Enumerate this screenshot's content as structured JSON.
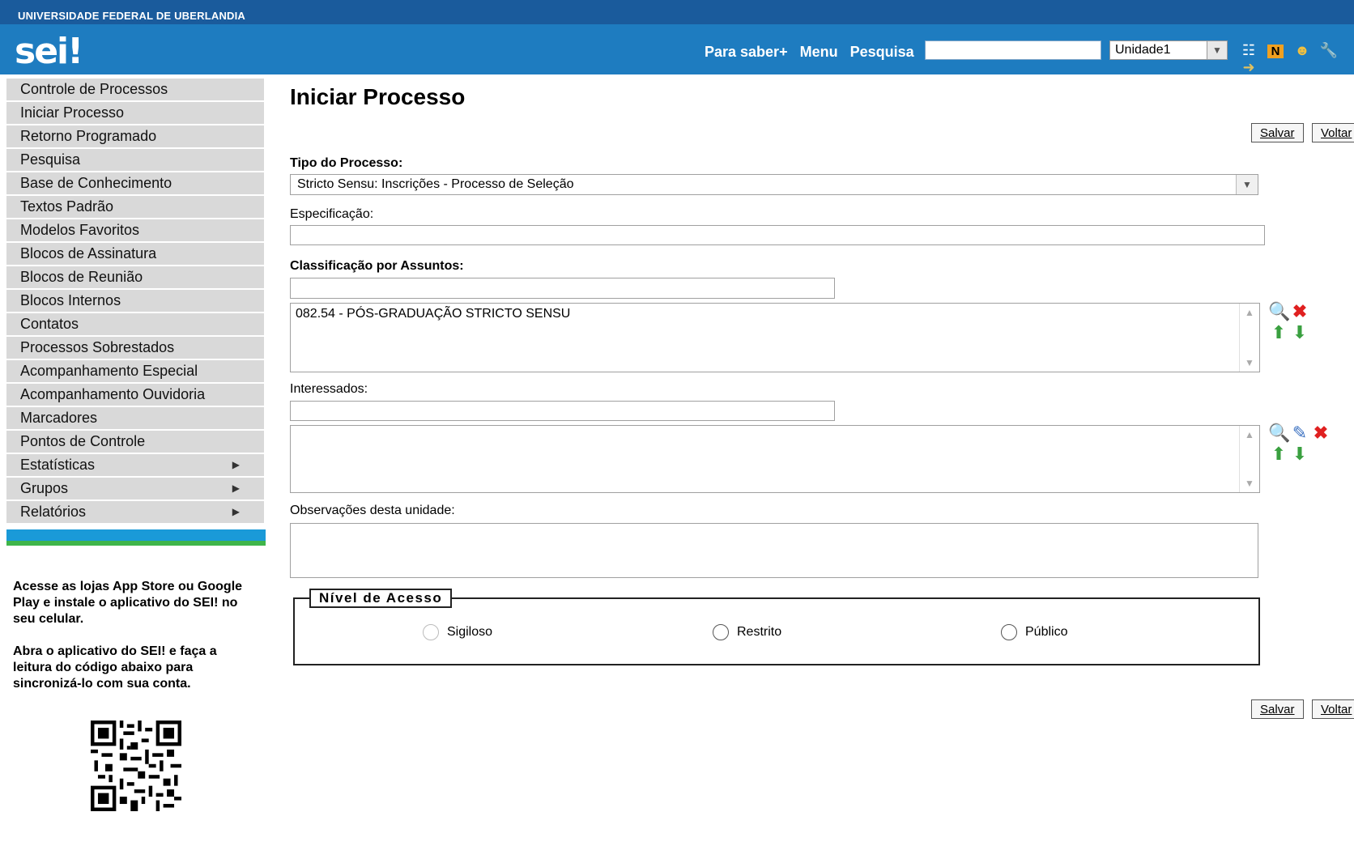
{
  "header": {
    "institution": "UNIVERSIDADE FEDERAL DE UBERLANDIA",
    "logo": "sei!",
    "nav": [
      "Para saber+",
      "Menu",
      "Pesquisa"
    ],
    "search_value": "",
    "unit_select": "Unidade1",
    "icons": [
      "list-icon",
      "n-badge-icon",
      "user-icon",
      "wrench-icon",
      "exit-icon"
    ]
  },
  "sidebar": {
    "items": [
      {
        "label": "Controle de Processos"
      },
      {
        "label": "Iniciar Processo"
      },
      {
        "label": "Retorno Programado"
      },
      {
        "label": "Pesquisa"
      },
      {
        "label": "Base de Conhecimento"
      },
      {
        "label": "Textos Padrão"
      },
      {
        "label": "Modelos Favoritos"
      },
      {
        "label": "Blocos de Assinatura"
      },
      {
        "label": "Blocos de Reunião"
      },
      {
        "label": "Blocos Internos"
      },
      {
        "label": "Contatos"
      },
      {
        "label": "Processos Sobrestados"
      },
      {
        "label": "Acompanhamento Especial"
      },
      {
        "label": "Acompanhamento Ouvidoria"
      },
      {
        "label": "Marcadores"
      },
      {
        "label": "Pontos de Controle"
      },
      {
        "label": "Estatísticas"
      },
      {
        "label": "Grupos"
      },
      {
        "label": "Relatórios"
      }
    ],
    "app_text_1": "Acesse as lojas App Store ou Google Play e instale o aplicativo do SEI! no seu celular.",
    "app_text_2": "Abra o aplicativo do SEI! e faça a leitura do código abaixo para sincronizá-lo com sua conta."
  },
  "main": {
    "title": "Iniciar Processo",
    "save_label": "Salvar",
    "back_label": "Voltar",
    "tipo_label": "Tipo do Processo:",
    "tipo_value": "Stricto Sensu: Inscrições - Processo de Seleção",
    "especificacao_label": "Especificação:",
    "especificacao_value": "",
    "classificacao_label": "Classificação por Assuntos:",
    "classificacao_items": [
      "082.54 - PÓS-GRADUAÇÃO STRICTO SENSU"
    ],
    "interessados_label": "Interessados:",
    "observacoes_label": "Observações desta unidade:",
    "nivel_legend": "Nível de Acesso",
    "nivel_options": [
      "Sigiloso",
      "Restrito",
      "Público"
    ]
  }
}
